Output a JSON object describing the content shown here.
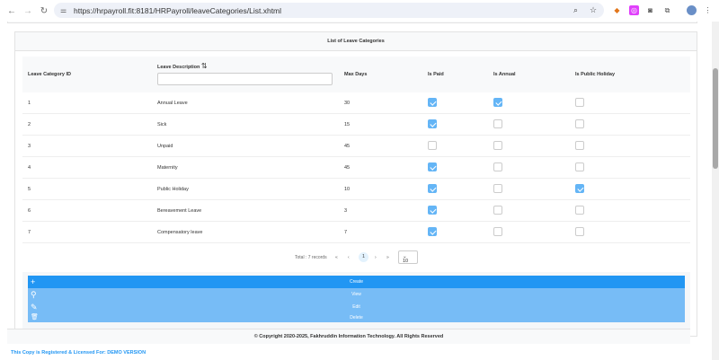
{
  "browser": {
    "url": "https://hrpayroll.fit:8181/HRPayroll/leaveCategories/List.xhtml"
  },
  "panel": {
    "title": "List of Leave Categories"
  },
  "table": {
    "headers": {
      "id": "Leave Category ID",
      "description": "Leave Description",
      "max_days": "Max Days",
      "is_paid": "Is Paid",
      "is_annual": "Is Annual",
      "is_public_holiday": "Is Public Holiday"
    },
    "sort_icon": "⇅",
    "filter_value": "",
    "rows": [
      {
        "id": "1",
        "description": "Annual Leave",
        "max_days": "30",
        "is_paid": true,
        "is_annual": true,
        "is_public_holiday": false
      },
      {
        "id": "2",
        "description": "Sick",
        "max_days": "15",
        "is_paid": true,
        "is_annual": false,
        "is_public_holiday": false
      },
      {
        "id": "3",
        "description": "Unpaid",
        "max_days": "45",
        "is_paid": false,
        "is_annual": false,
        "is_public_holiday": false
      },
      {
        "id": "4",
        "description": "Maternity",
        "max_days": "45",
        "is_paid": true,
        "is_annual": false,
        "is_public_holiday": false
      },
      {
        "id": "5",
        "description": "Public Holiday",
        "max_days": "10",
        "is_paid": true,
        "is_annual": false,
        "is_public_holiday": true
      },
      {
        "id": "6",
        "description": "Bereavement Leave",
        "max_days": "3",
        "is_paid": true,
        "is_annual": false,
        "is_public_holiday": false
      },
      {
        "id": "7",
        "description": "Compensatory leave",
        "max_days": "7",
        "is_paid": true,
        "is_annual": false,
        "is_public_holiday": false
      }
    ]
  },
  "pager": {
    "total": "Total : 7 records",
    "first": "«",
    "prev": "‹",
    "current": "1",
    "next": "›",
    "last": "»",
    "rows_per_page": "10"
  },
  "buttons": {
    "create": "Create",
    "view": "View",
    "edit": "Edit",
    "delete": "Delete"
  },
  "footer": {
    "copyright": "© Copyright 2020-2025, Fakhruddin Information Technology. All Rights Reserved",
    "license": "This Copy is Registered & Licensed For: DEMO VERSION"
  },
  "colors": {
    "primary": "#2196f3",
    "secondary": "#77bcf6",
    "checked": "#64b5f6"
  }
}
